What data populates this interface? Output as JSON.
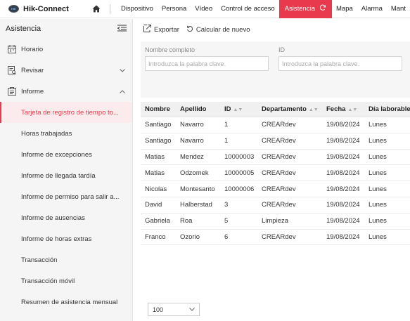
{
  "app": {
    "brand": "Hik-Connect",
    "logo_badge": "HIK"
  },
  "nav": {
    "items": [
      {
        "label": "Dispositivo",
        "active": false
      },
      {
        "label": "Persona",
        "active": false
      },
      {
        "label": "Vídeo",
        "active": false
      },
      {
        "label": "Control de acceso",
        "active": false
      },
      {
        "label": "Asistencia",
        "active": true
      },
      {
        "label": "Mapa",
        "active": false
      },
      {
        "label": "Alarma",
        "active": false
      },
      {
        "label": "Mant",
        "active": false
      }
    ]
  },
  "sidebar": {
    "title": "Asistencia",
    "groups": [
      {
        "label": "Horario",
        "icon": "calendar-icon",
        "expandable": false
      },
      {
        "label": "Revisar",
        "icon": "review-icon",
        "expandable": true,
        "expanded": false
      },
      {
        "label": "Informe",
        "icon": "report-icon",
        "expandable": true,
        "expanded": true
      }
    ],
    "sub_items": [
      {
        "label": "Tarjeta de registro de tiempo to...",
        "active": true
      },
      {
        "label": "Horas trabajadas",
        "active": false
      },
      {
        "label": "Informe de excepciones",
        "active": false
      },
      {
        "label": "Informe de llegada tardía",
        "active": false
      },
      {
        "label": "Informe de permiso para salir a...",
        "active": false
      },
      {
        "label": "Informe de ausencias",
        "active": false
      },
      {
        "label": "Informe de horas extras",
        "active": false
      },
      {
        "label": "Transacción",
        "active": false
      },
      {
        "label": "Transacción móvil",
        "active": false
      },
      {
        "label": "Resumen de asistencia mensual",
        "active": false
      }
    ]
  },
  "toolbar": {
    "export_label": "Exportar",
    "recalc_label": "Calcular de nuevo"
  },
  "filters": {
    "name": {
      "label": "Nombre completo",
      "placeholder": "Introduzca la palabra clave.",
      "value": ""
    },
    "id": {
      "label": "ID",
      "placeholder": "Introduzca la palabra clave.",
      "value": ""
    }
  },
  "table": {
    "columns": [
      "Nombre",
      "Apellido",
      "ID",
      "Departamento",
      "Fecha",
      "Día laborable"
    ],
    "rows": [
      [
        "Santiago",
        "Navarro",
        "1",
        "CREARdev",
        "19/08/2024",
        "Lunes"
      ],
      [
        "Santiago",
        "Navarro",
        "1",
        "CREARdev",
        "19/08/2024",
        "Lunes"
      ],
      [
        "Matias",
        "Mendez",
        "10000003",
        "CREARdev",
        "19/08/2024",
        "Lunes"
      ],
      [
        "Matias",
        "Odzomek",
        "10000005",
        "CREARdev",
        "19/08/2024",
        "Lunes"
      ],
      [
        "Nicolas",
        "Montesanto",
        "10000006",
        "CREARdev",
        "19/08/2024",
        "Lunes"
      ],
      [
        "David",
        "Halberstad",
        "3",
        "CREARdev",
        "19/08/2024",
        "Lunes"
      ],
      [
        "Gabriela",
        "Roa",
        "5",
        "Limpieza",
        "19/08/2024",
        "Lunes"
      ],
      [
        "Franco",
        "Ozorio",
        "6",
        "CREARdev",
        "19/08/2024",
        "Lunes"
      ]
    ]
  },
  "pagination": {
    "page_size": "100"
  },
  "colors": {
    "accent": "#e83a4c",
    "sidebar_bg": "#f5f5f5",
    "active_sub_bg": "#fcebec"
  }
}
